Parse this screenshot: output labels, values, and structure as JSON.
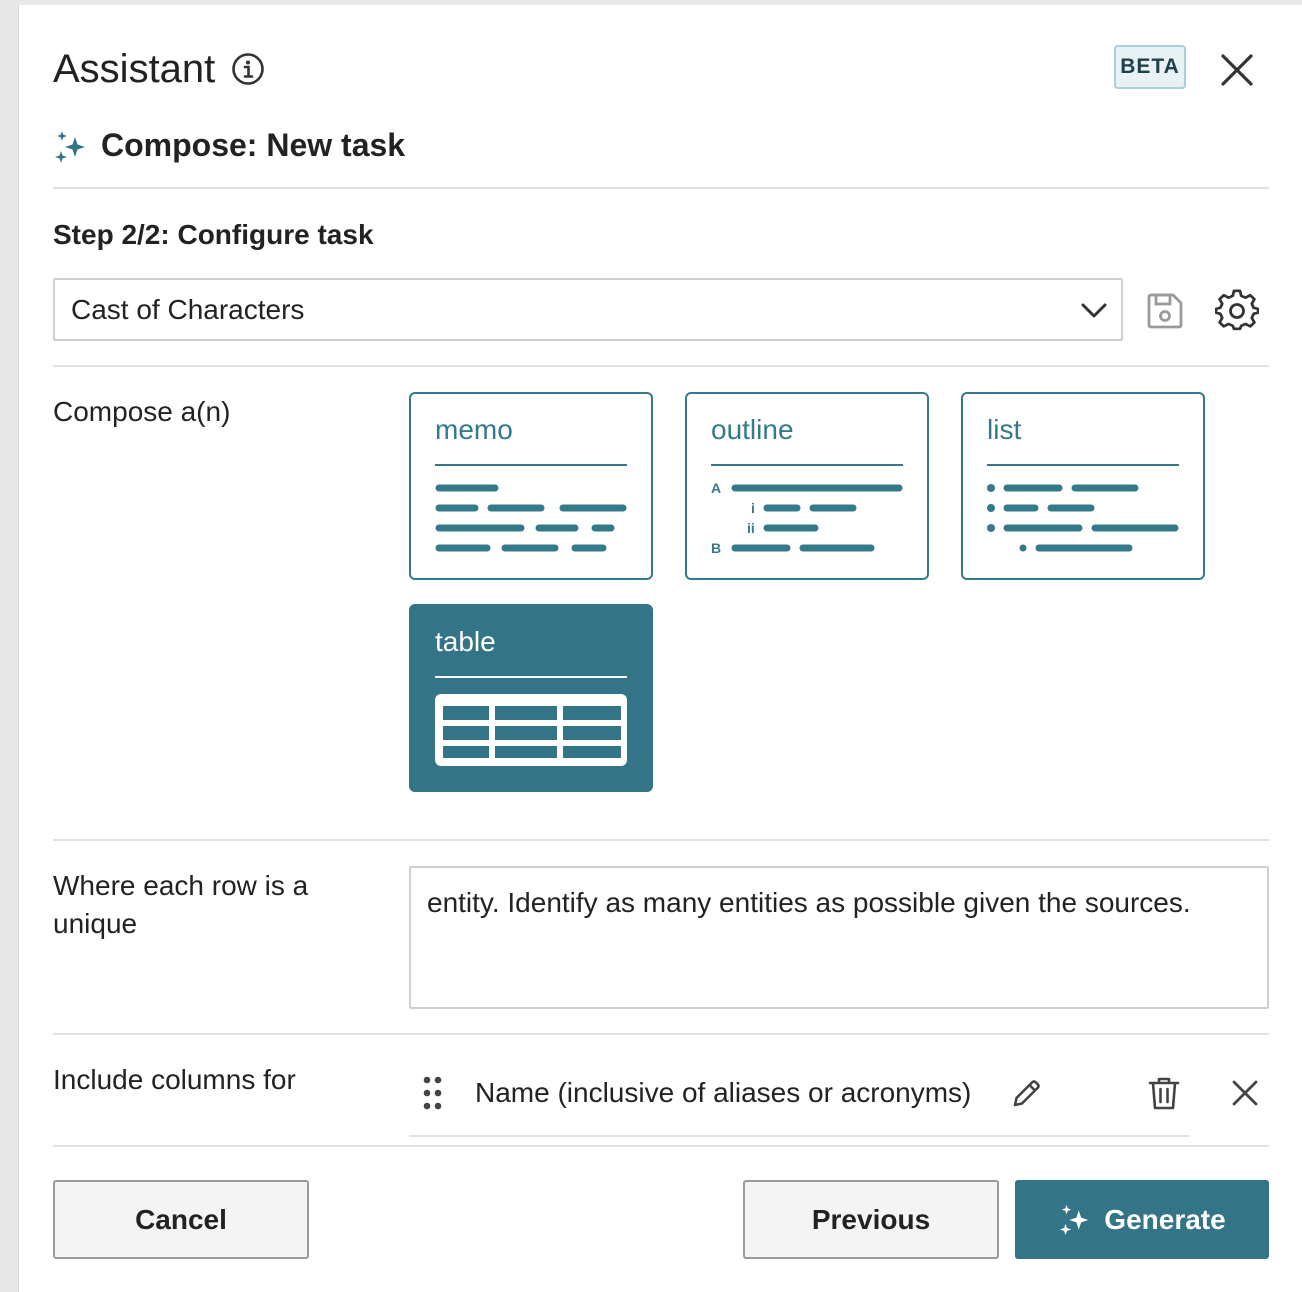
{
  "header": {
    "title": "Assistant",
    "badge": "BETA"
  },
  "compose": {
    "title": "Compose: New task"
  },
  "step": {
    "label": "Step 2/2: Configure task"
  },
  "template_select": {
    "value": "Cast of Characters"
  },
  "format": {
    "label": "Compose a(n)",
    "options": [
      {
        "label": "memo",
        "selected": false
      },
      {
        "label": "outline",
        "selected": false
      },
      {
        "label": "list",
        "selected": false
      },
      {
        "label": "table",
        "selected": true
      }
    ],
    "outline_markers": [
      "A",
      "i",
      "ii",
      "B"
    ]
  },
  "row_definition": {
    "label": "Where each row is a unique",
    "value": "entity. Identify as many entities as possible given the sources."
  },
  "columns": {
    "label": "Include columns for",
    "items": [
      {
        "name": "Name (inclusive of aliases or acronyms)"
      }
    ]
  },
  "footer": {
    "cancel": "Cancel",
    "previous": "Previous",
    "generate": "Generate"
  },
  "colors": {
    "accent": "#337486",
    "beta_bg": "#e8f2f5",
    "beta_border": "#a9cfdc"
  }
}
